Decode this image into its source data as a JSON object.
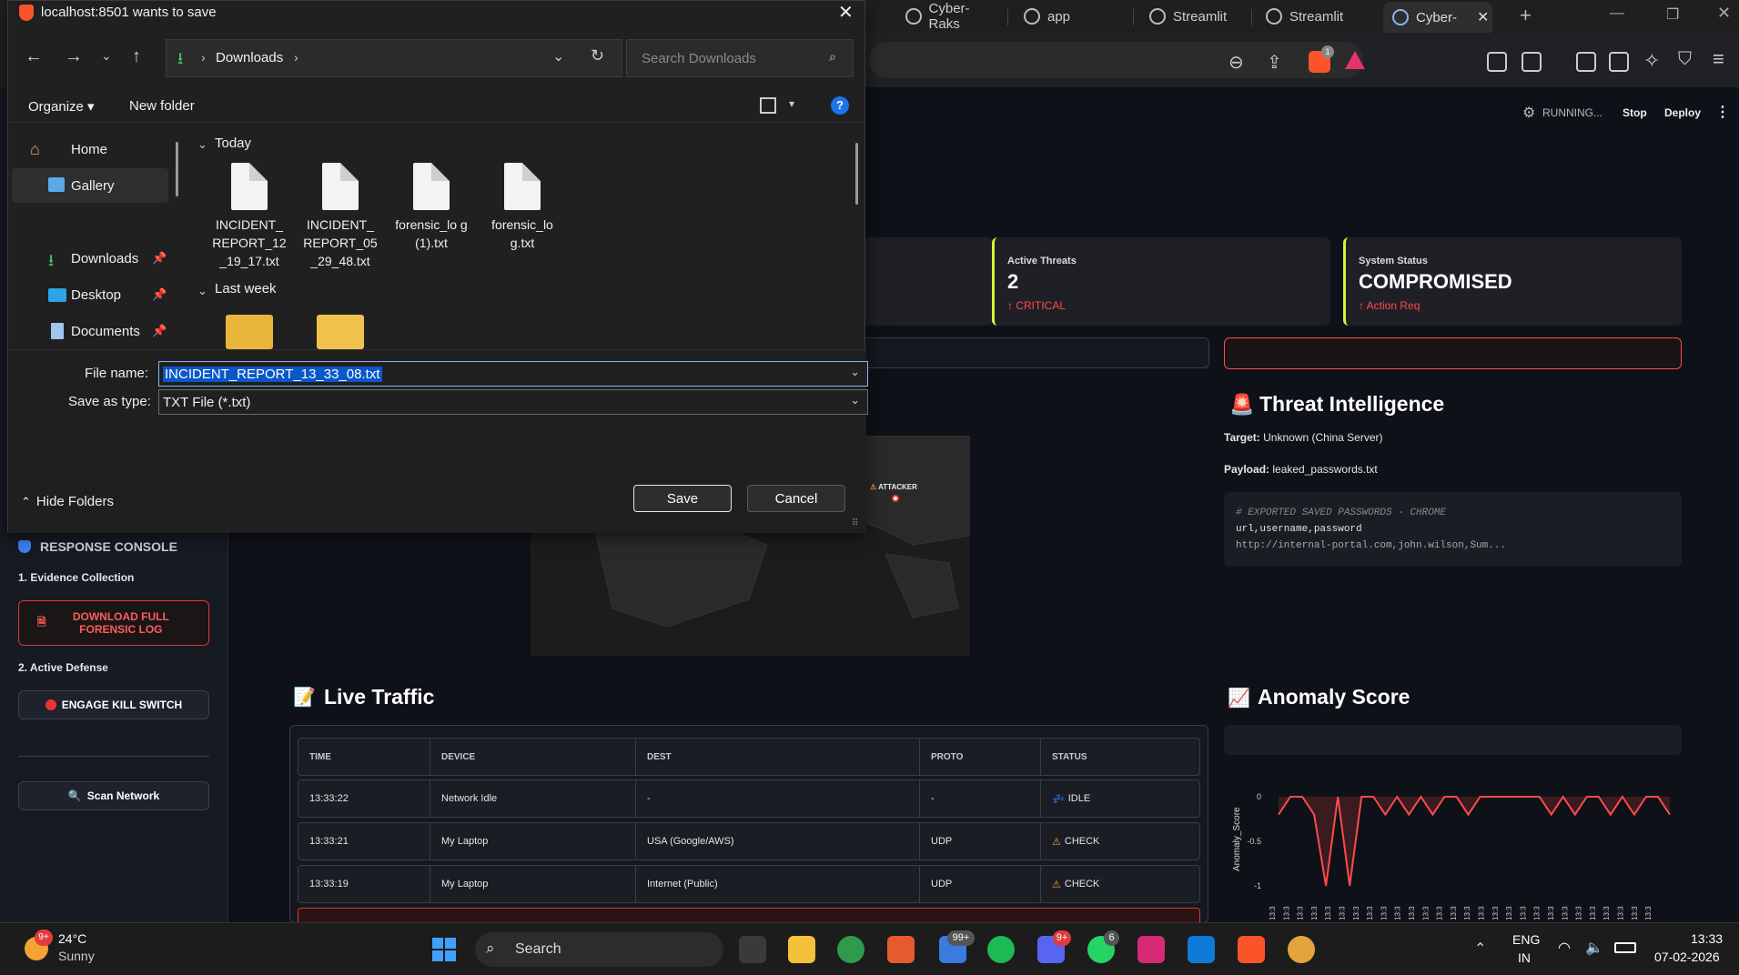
{
  "browser": {
    "tabs": [
      {
        "label": "Cyber-Raks"
      },
      {
        "label": "app"
      },
      {
        "label": "Streamlit"
      },
      {
        "label": "Streamlit"
      },
      {
        "label": "Cyber-"
      }
    ],
    "shield_badge": "1"
  },
  "app": {
    "status": "RUNNING...",
    "stop_label": "Stop",
    "deploy_label": "Deploy",
    "menu_glyph": "⋮"
  },
  "sidebar": {
    "console_title": "RESPONSE CONSOLE",
    "section1": "1. Evidence Collection",
    "download_btn": "DOWNLOAD FULL FORENSIC LOG",
    "section2": "2. Active Defense",
    "kill_btn": "ENGAGE KILL SWITCH",
    "scan_btn": "Scan Network"
  },
  "metrics": {
    "threats_label": "Active Threats",
    "threats_value": "2",
    "threats_delta": "↑ CRITICAL",
    "status_label": "System Status",
    "status_value": "COMPROMISED",
    "status_delta": "↑ Action Req"
  },
  "threat_intel": {
    "title": "Threat Intelligence",
    "target_label": "Target:",
    "target_value": "Unknown (China Server)",
    "payload_label": "Payload:",
    "payload_value": "leaked_passwords.txt",
    "code_comment": "# EXPORTED SAVED PASSWORDS - CHROME",
    "code_line1": "url,username,password",
    "code_line2": "http://internal-portal.com,john.wilson,Sum..."
  },
  "map": {
    "attacker_label": "ATTACKER"
  },
  "traffic": {
    "title": "Live Traffic",
    "columns": [
      "TIME",
      "DEVICE",
      "DEST",
      "PROTO",
      "STATUS"
    ],
    "rows": [
      [
        "13:33:22",
        "Network Idle",
        "-",
        "-",
        "IDLE"
      ],
      [
        "13:33:21",
        "My Laptop",
        "USA (Google/AWS)",
        "UDP",
        "CHECK"
      ],
      [
        "13:33:19",
        "My Laptop",
        "Internet (Public)",
        "UDP",
        "CHECK"
      ]
    ]
  },
  "anomaly": {
    "title": "Anomaly Score",
    "ylabel": "Anomaly_Score",
    "xtick_label": "13:3",
    "color": "#ff4b4b"
  },
  "chart_data": {
    "type": "line",
    "title": "Anomaly Score",
    "ylabel": "Anomaly_Score",
    "ylim": [
      -1,
      0
    ],
    "yticks": [
      "0",
      "-0.5",
      "-1"
    ],
    "values": [
      -0.2,
      0,
      0,
      -0.2,
      -1,
      0,
      -1,
      0,
      0,
      -0.2,
      0,
      -0.2,
      0,
      -0.2,
      0,
      0,
      -0.2,
      0,
      0,
      0,
      0,
      0,
      0,
      -0.2,
      0,
      -0.2,
      0,
      0,
      -0.2,
      0,
      -0.2,
      0,
      0,
      -0.2
    ]
  },
  "dialog": {
    "title": "localhost:8501 wants to save",
    "location": "Downloads",
    "search_placeholder": "Search Downloads",
    "organize": "Organize",
    "new_folder": "New folder",
    "help": "?",
    "nav": [
      "Home",
      "Gallery",
      "Downloads",
      "Desktop",
      "Documents"
    ],
    "group_today": "Today",
    "group_lastweek": "Last week",
    "files": [
      "INCIDENT_ REPORT_12 _19_17.txt",
      "INCIDENT_ REPORT_05 _29_48.txt",
      "forensic_lo g (1).txt",
      "forensic_lo g.txt"
    ],
    "filename_label": "File name:",
    "filename_value": "INCIDENT_REPORT_13_33_08.txt",
    "type_label": "Save as type:",
    "type_value": "TXT File (*.txt)",
    "hide_folders": "Hide Folders",
    "save": "Save",
    "cancel": "Cancel"
  },
  "taskbar": {
    "temp": "24°C",
    "weather": "Sunny",
    "weather_badge": "9+",
    "search": "Search",
    "badge_teams": "99+",
    "badge_discord": "9+",
    "badge_whatsapp": "6",
    "lang": "ENG",
    "region": "IN",
    "time": "13:33",
    "date": "07-02-2026"
  }
}
